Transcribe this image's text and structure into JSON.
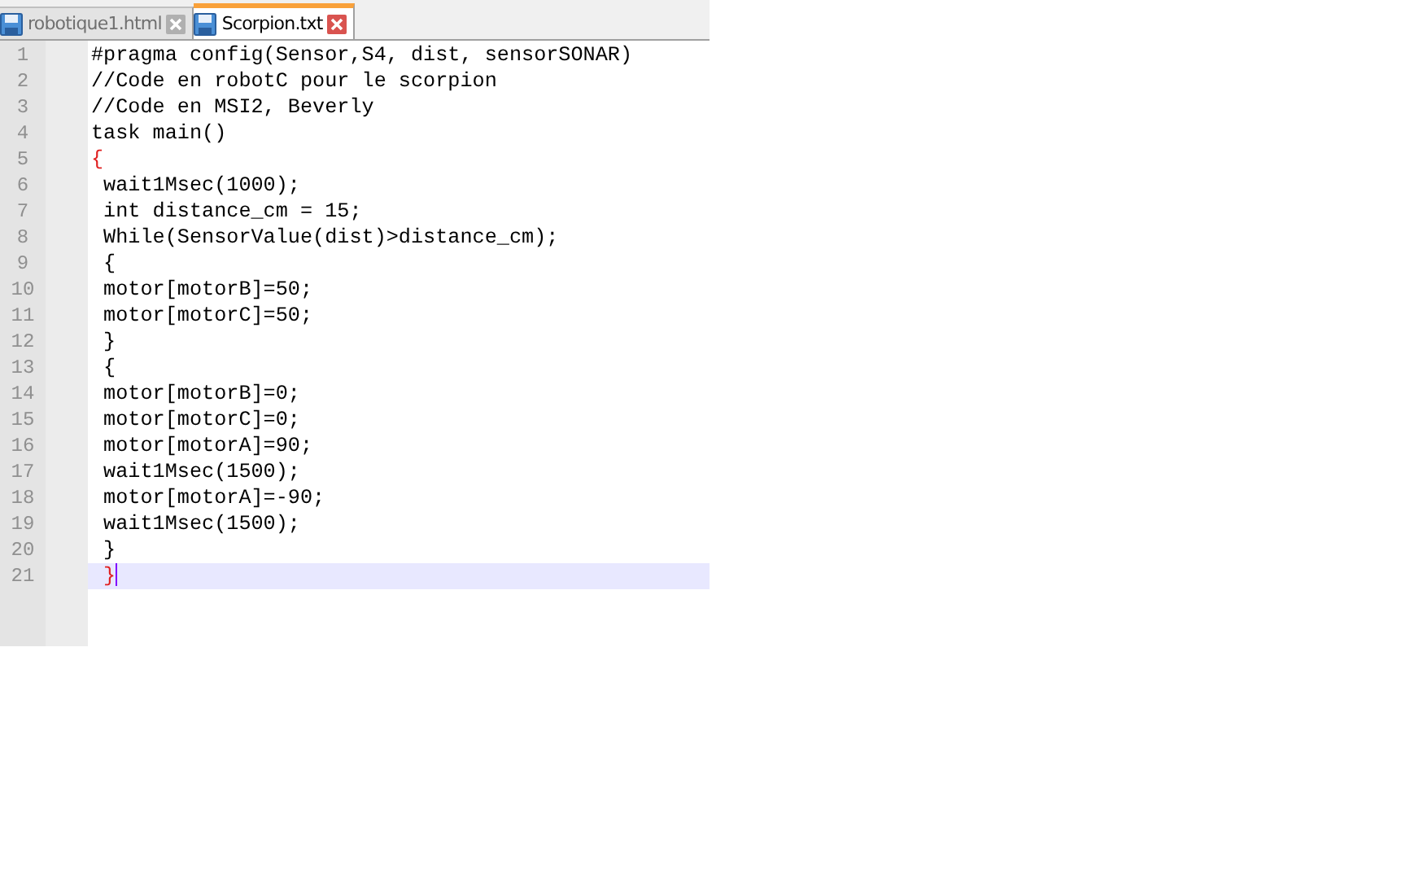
{
  "tabs": [
    {
      "label": "robotique1.html",
      "selected": false
    },
    {
      "label": "Scorpion.txt",
      "selected": true
    }
  ],
  "lines": [
    {
      "number": "1",
      "text": "#pragma config(Sensor,S4, dist, sensorSONAR)",
      "brace_match": false,
      "current": false
    },
    {
      "number": "2",
      "text": "//Code en robotC pour le scorpion",
      "brace_match": false,
      "current": false
    },
    {
      "number": "3",
      "text": "//Code en MSI2, Beverly",
      "brace_match": false,
      "current": false
    },
    {
      "number": "4",
      "text": "task main()",
      "brace_match": false,
      "current": false
    },
    {
      "number": "5",
      "text": "{",
      "brace_match": true,
      "current": false
    },
    {
      "number": "6",
      "text": " wait1Msec(1000);",
      "brace_match": false,
      "current": false
    },
    {
      "number": "7",
      "text": " int distance_cm = 15;",
      "brace_match": false,
      "current": false
    },
    {
      "number": "8",
      "text": " While(SensorValue(dist)>distance_cm);",
      "brace_match": false,
      "current": false
    },
    {
      "number": "9",
      "text": " {",
      "brace_match": false,
      "current": false
    },
    {
      "number": "10",
      "text": " motor[motorB]=50;",
      "brace_match": false,
      "current": false
    },
    {
      "number": "11",
      "text": " motor[motorC]=50;",
      "brace_match": false,
      "current": false
    },
    {
      "number": "12",
      "text": " }",
      "brace_match": false,
      "current": false
    },
    {
      "number": "13",
      "text": " {",
      "brace_match": false,
      "current": false
    },
    {
      "number": "14",
      "text": " motor[motorB]=0;",
      "brace_match": false,
      "current": false
    },
    {
      "number": "15",
      "text": " motor[motorC]=0;",
      "brace_match": false,
      "current": false
    },
    {
      "number": "16",
      "text": " motor[motorA]=90;",
      "brace_match": false,
      "current": false
    },
    {
      "number": "17",
      "text": " wait1Msec(1500);",
      "brace_match": false,
      "current": false
    },
    {
      "number": "18",
      "text": " motor[motorA]=-90;",
      "brace_match": false,
      "current": false
    },
    {
      "number": "19",
      "text": " wait1Msec(1500);",
      "brace_match": false,
      "current": false
    },
    {
      "number": "20",
      "text": " }",
      "brace_match": false,
      "current": false
    },
    {
      "number": "21",
      "text": " }",
      "brace_match": true,
      "current": true
    }
  ]
}
